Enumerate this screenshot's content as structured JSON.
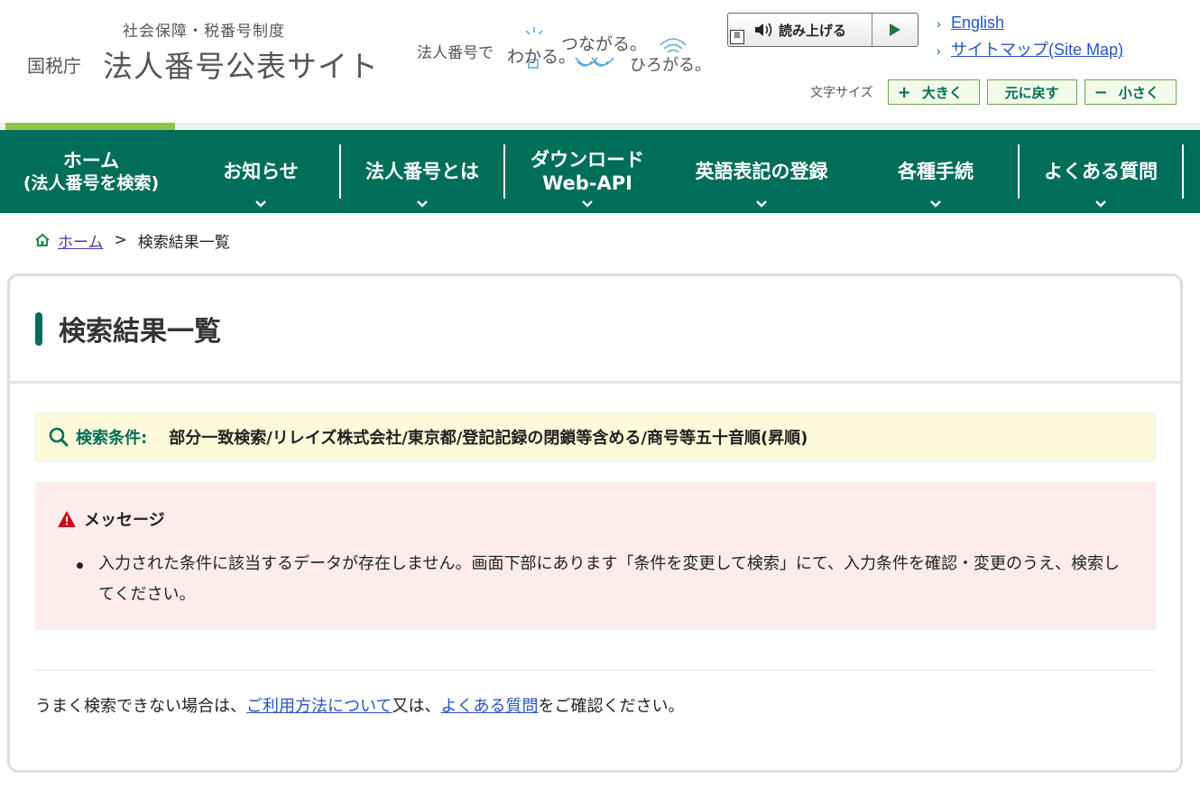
{
  "header": {
    "logo_sub": "社会保障・税番号制度",
    "logo_nta": "国税庁",
    "logo_main": "法人番号公表サイト",
    "tagline_a": "法人番号で",
    "tagline_b": "わかる。",
    "tagline_c": "つながる。",
    "tagline_d": "ひろがる。",
    "read_aloud_label": "読み上げる",
    "links": [
      {
        "label": "English"
      },
      {
        "label": "サイトマップ(Site Map)"
      }
    ],
    "font_size": {
      "label": "文字サイズ",
      "bigger": "大きく",
      "reset": "元に戻す",
      "smaller": "小さく"
    }
  },
  "nav": {
    "items": [
      {
        "line1": "ホーム",
        "line2": "(法人番号を検索)"
      },
      {
        "line1": "お知らせ"
      },
      {
        "line1": "法人番号とは"
      },
      {
        "line1": "ダウンロード",
        "line2": "Web-API"
      },
      {
        "line1": "英語表記の登録"
      },
      {
        "line1": "各種手続"
      },
      {
        "line1": "よくある質問"
      }
    ]
  },
  "breadcrumb": {
    "home": "ホーム",
    "separator": ">",
    "current": "検索結果一覧"
  },
  "main": {
    "title": "検索結果一覧",
    "condition_label": "検索条件:",
    "condition_text": "部分一致検索/リレイズ株式会社/東京都/登記記録の閉鎖等含める/商号等五十音順(昇順)",
    "message_heading": "メッセージ",
    "messages": [
      "入力された条件に該当するデータが存在しません。画面下部にあります「条件を変更して検索」にて、入力条件を確認・変更のうえ、検索してください。"
    ],
    "help_prefix": "うまく検索できない場合は、",
    "help_link1": "ご利用方法について",
    "help_mid": "又は、",
    "help_link2": "よくある質問",
    "help_suffix": "をご確認ください。"
  },
  "colors": {
    "brand_green": "#006e59",
    "accent_lime": "#8dc63f",
    "link_blue": "#2556c0",
    "condition_bg": "#fdfad9",
    "message_bg": "#fdeceb",
    "warning_red": "#d0021b"
  }
}
